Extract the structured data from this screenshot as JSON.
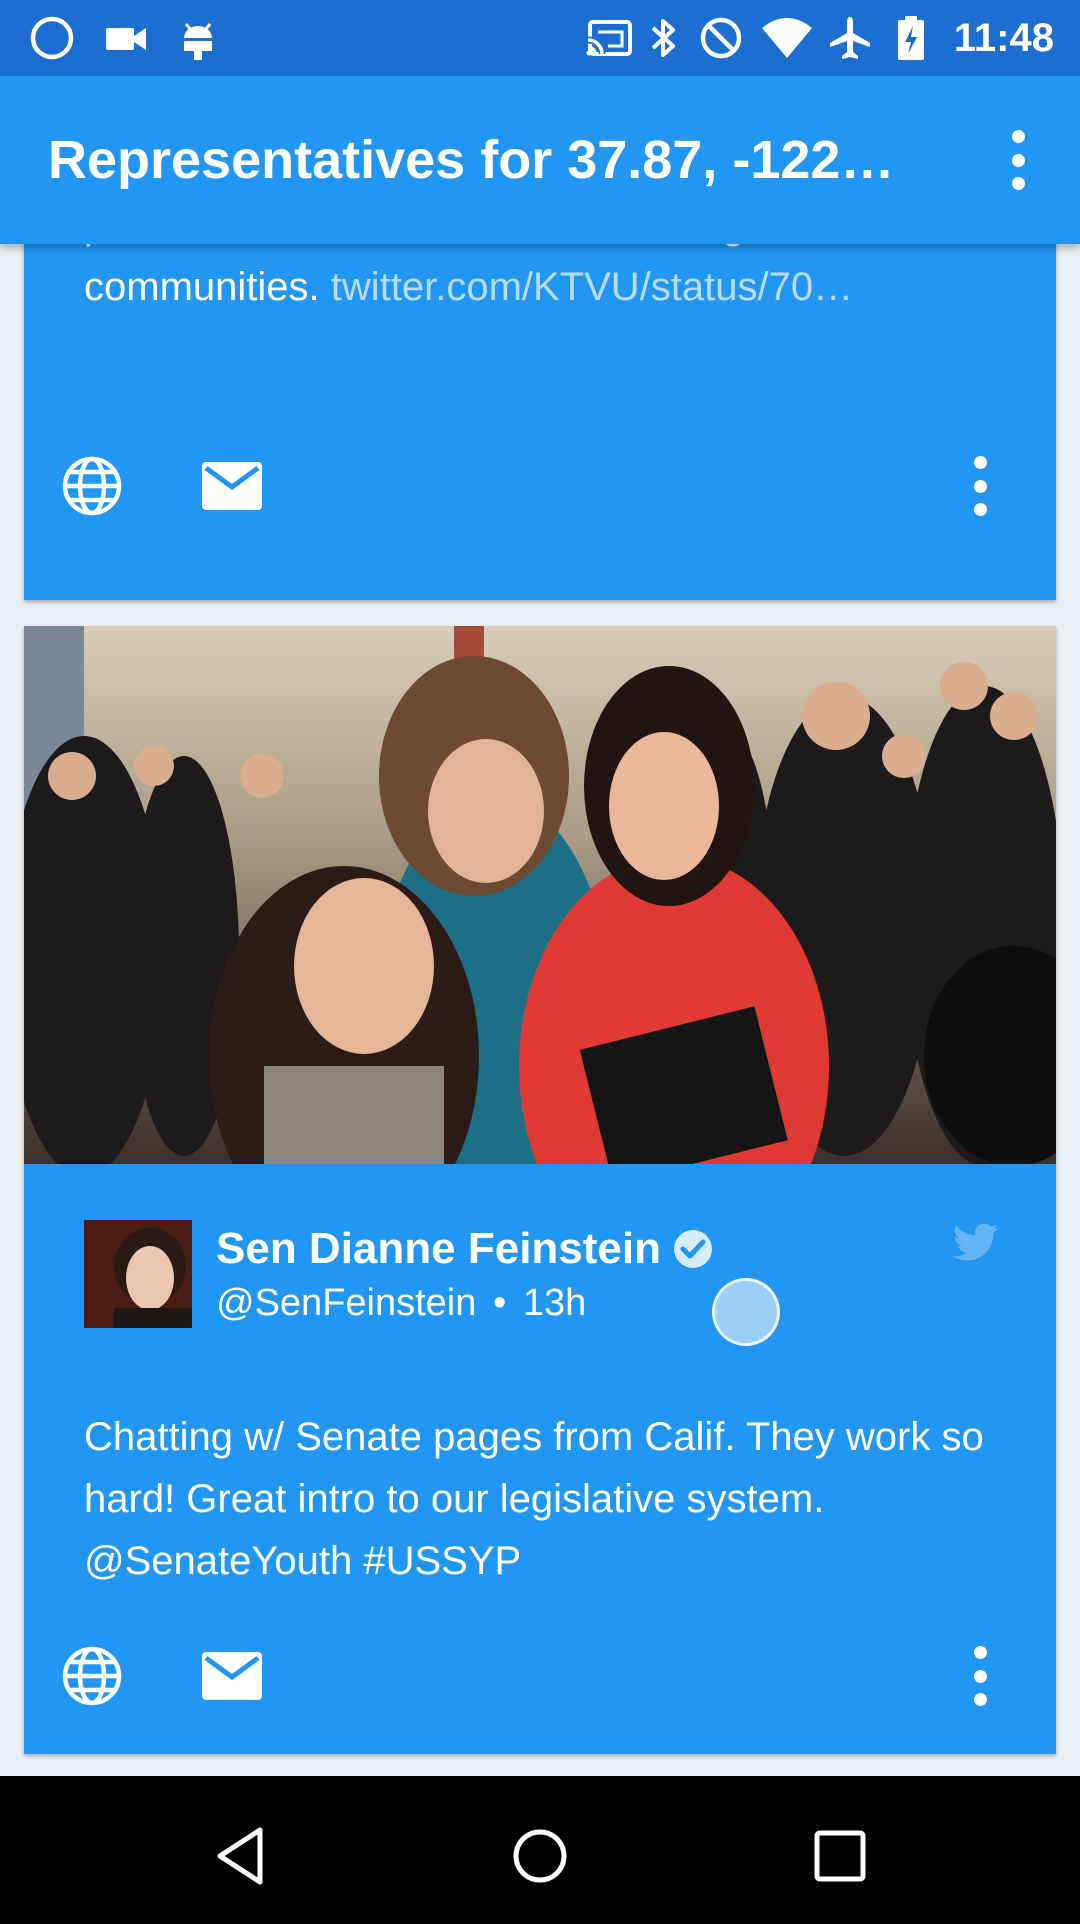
{
  "status_bar": {
    "time": "11:48",
    "left_icons": [
      "circle-icon",
      "video-camera-icon",
      "android-debug-icon"
    ],
    "right_icons": [
      "cast-icon",
      "bluetooth-icon",
      "do-not-disturb-icon",
      "wifi-icon",
      "airplane-mode-icon",
      "battery-charging-icon"
    ]
  },
  "app_bar": {
    "title": "Representatives for 37.87, -122…",
    "menu_icon": "more-vert-icon"
  },
  "cards": [
    {
      "text": "provide assistance to our crab fishing communities.",
      "link": "twitter.com/KTVU/status/70…",
      "actions": [
        "globe-icon",
        "email-icon",
        "more-vert-icon"
      ]
    },
    {
      "author": "Sen Dianne Feinstein",
      "verified": true,
      "handle": "@SenFeinstein",
      "separator": "•",
      "time_ago": "13h",
      "text": "Chatting w/ Senate pages from Calif. They work so hard! Great intro to our legislative system. @SenateYouth #USSYP",
      "actions": [
        "globe-icon",
        "email-icon",
        "more-vert-icon"
      ]
    }
  ],
  "nav_bar": {
    "buttons": [
      "back-icon",
      "home-icon",
      "recents-icon"
    ]
  },
  "colors": {
    "status_bar": "#1c6fd0",
    "app_bar": "#2196f3",
    "card": "#2196f3",
    "link": "#b8dcfb"
  }
}
